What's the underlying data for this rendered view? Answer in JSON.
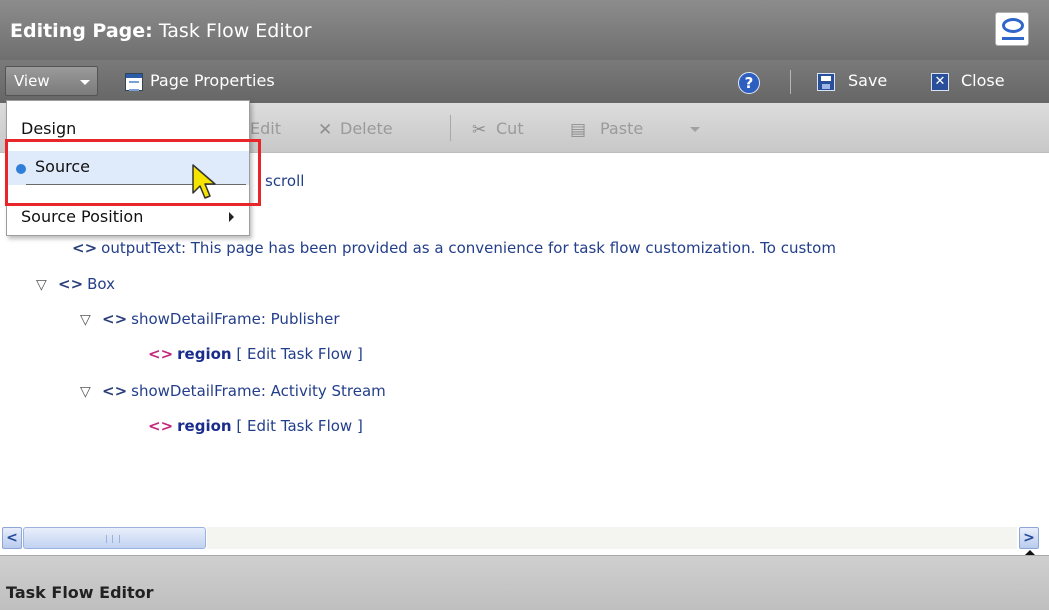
{
  "window": {
    "title_prefix": "Editing Page:",
    "title_name": "Task Flow Editor"
  },
  "toolbar": {
    "view_label": "View",
    "page_properties_label": "Page Properties",
    "help_symbol": "?",
    "save_label": "Save",
    "close_label": "Close"
  },
  "edit_toolbar": {
    "edit_label": "Edit",
    "delete_label": "Delete",
    "cut_label": "Cut",
    "paste_label": "Paste"
  },
  "view_menu": {
    "items": [
      {
        "label": "Design",
        "selected": false
      },
      {
        "label": "Source",
        "selected": true
      },
      {
        "label": "Source Position",
        "has_submenu": true
      }
    ]
  },
  "tree": {
    "partial_scroll": "scroll",
    "output_text": "outputText: This page has been provided as a convenience for task flow customization. To custom",
    "box_label": "Box",
    "frames": [
      {
        "label": "showDetailFrame: Publisher",
        "region_label": "region",
        "edit_link": "[ Edit Task Flow ]"
      },
      {
        "label": "showDetailFrame: Activity Stream",
        "region_label": "region",
        "edit_link": "[ Edit Task Flow ]"
      }
    ]
  },
  "bottom_panel": {
    "title": "Task Flow Editor"
  },
  "colors": {
    "highlight_box": "#e8262a",
    "selected_dot": "#2f7fd8",
    "region_icon": "#c3267a"
  },
  "icons": {
    "logo": "oracle-logo-icon",
    "help": "help-icon",
    "save": "save-icon",
    "close": "close-icon"
  }
}
